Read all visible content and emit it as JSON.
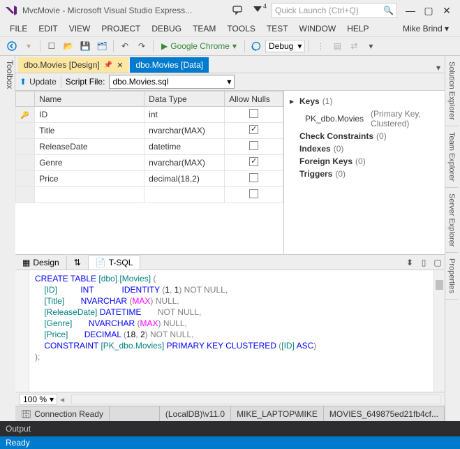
{
  "window": {
    "title": "MvcMovie - Microsoft Visual Studio Express...",
    "notif_count": "4",
    "search_placeholder": "Quick Launch (Ctrl+Q)"
  },
  "menu": {
    "items": [
      "FILE",
      "EDIT",
      "VIEW",
      "PROJECT",
      "DEBUG",
      "TEAM",
      "TOOLS",
      "TEST",
      "WINDOW",
      "HELP"
    ],
    "user": "Mike Brind"
  },
  "toolbar": {
    "browser": "Google Chrome",
    "config": "Debug"
  },
  "leftrail": {
    "label": "Toolbox"
  },
  "rightrail": {
    "tabs": [
      "Solution Explorer",
      "Team Explorer",
      "Server Explorer",
      "Properties"
    ]
  },
  "doctabs": {
    "active": "dbo.Movies [Design]",
    "inactive": "dbo.Movies [Data]"
  },
  "designer_toolbar": {
    "update": "Update",
    "script_label": "Script File:",
    "script_value": "dbo.Movies.sql"
  },
  "columns_grid": {
    "headers": {
      "name": "Name",
      "datatype": "Data Type",
      "allow_nulls": "Allow Nulls"
    },
    "rows": [
      {
        "pk": true,
        "name": "ID",
        "datatype": "int",
        "allow_nulls": false
      },
      {
        "pk": false,
        "name": "Title",
        "datatype": "nvarchar(MAX)",
        "allow_nulls": true
      },
      {
        "pk": false,
        "name": "ReleaseDate",
        "datatype": "datetime",
        "allow_nulls": false
      },
      {
        "pk": false,
        "name": "Genre",
        "datatype": "nvarchar(MAX)",
        "allow_nulls": true
      },
      {
        "pk": false,
        "name": "Price",
        "datatype": "decimal(18,2)",
        "allow_nulls": false
      }
    ]
  },
  "keys_pane": {
    "keys_label": "Keys",
    "keys_count": "(1)",
    "key_name": "PK_dbo.Movies",
    "key_meta": "(Primary Key, Clustered)",
    "check_label": "Check Constraints",
    "check_count": "(0)",
    "index_label": "Indexes",
    "index_count": "(0)",
    "fk_label": "Foreign Keys",
    "fk_count": "(0)",
    "trig_label": "Triggers",
    "trig_count": "(0)"
  },
  "bottom_tabs": {
    "design": "Design",
    "tsql": "T-SQL"
  },
  "sql": {
    "l1a": "CREATE TABLE ",
    "l1b": "[dbo]",
    "l1c": ".",
    "l1d": "[Movies]",
    "l1e": " (",
    "l2a": "    [ID]          ",
    "l2b": "INT",
    "l2c": "            ",
    "l2d": "IDENTITY ",
    "l2e": "(",
    "l2f": "1",
    "l2g": ", ",
    "l2h": "1",
    "l2i": ") ",
    "l2j": "NOT NULL",
    "l2k": ",",
    "l3a": "    [Title]       ",
    "l3b": "NVARCHAR ",
    "l3c": "(",
    "l3d": "MAX",
    "l3e": ") ",
    "l3f": "NULL",
    "l3g": ",",
    "l4a": "    [ReleaseDate] ",
    "l4b": "DATETIME",
    "l4c": "       ",
    "l4d": "NOT NULL",
    "l4e": ",",
    "l5a": "    [Genre]       ",
    "l5b": "NVARCHAR ",
    "l5c": "(",
    "l5d": "MAX",
    "l5e": ") ",
    "l5f": "NULL",
    "l5g": ",",
    "l6a": "    [Price]       ",
    "l6b": "DECIMAL ",
    "l6c": "(",
    "l6d": "18",
    "l6e": ", ",
    "l6f": "2",
    "l6g": ") ",
    "l6h": "NOT NULL",
    "l6i": ",",
    "l7a": "    ",
    "l7b": "CONSTRAINT ",
    "l7c": "[PK_dbo.Movies] ",
    "l7d": "PRIMARY KEY CLUSTERED ",
    "l7e": "(",
    "l7f": "[ID] ",
    "l7g": "ASC",
    "l7h": ")",
    "l8": ");"
  },
  "zoom": {
    "value": "100 %"
  },
  "dbstatus": {
    "conn": "Connection Ready",
    "server": "(LocalDB)\\v11.0",
    "user": "MIKE_LAPTOP\\MIKE",
    "db": "MOVIES_649875ed21fb4cf..."
  },
  "output": {
    "title": "Output"
  },
  "statusbar": {
    "text": "Ready"
  }
}
